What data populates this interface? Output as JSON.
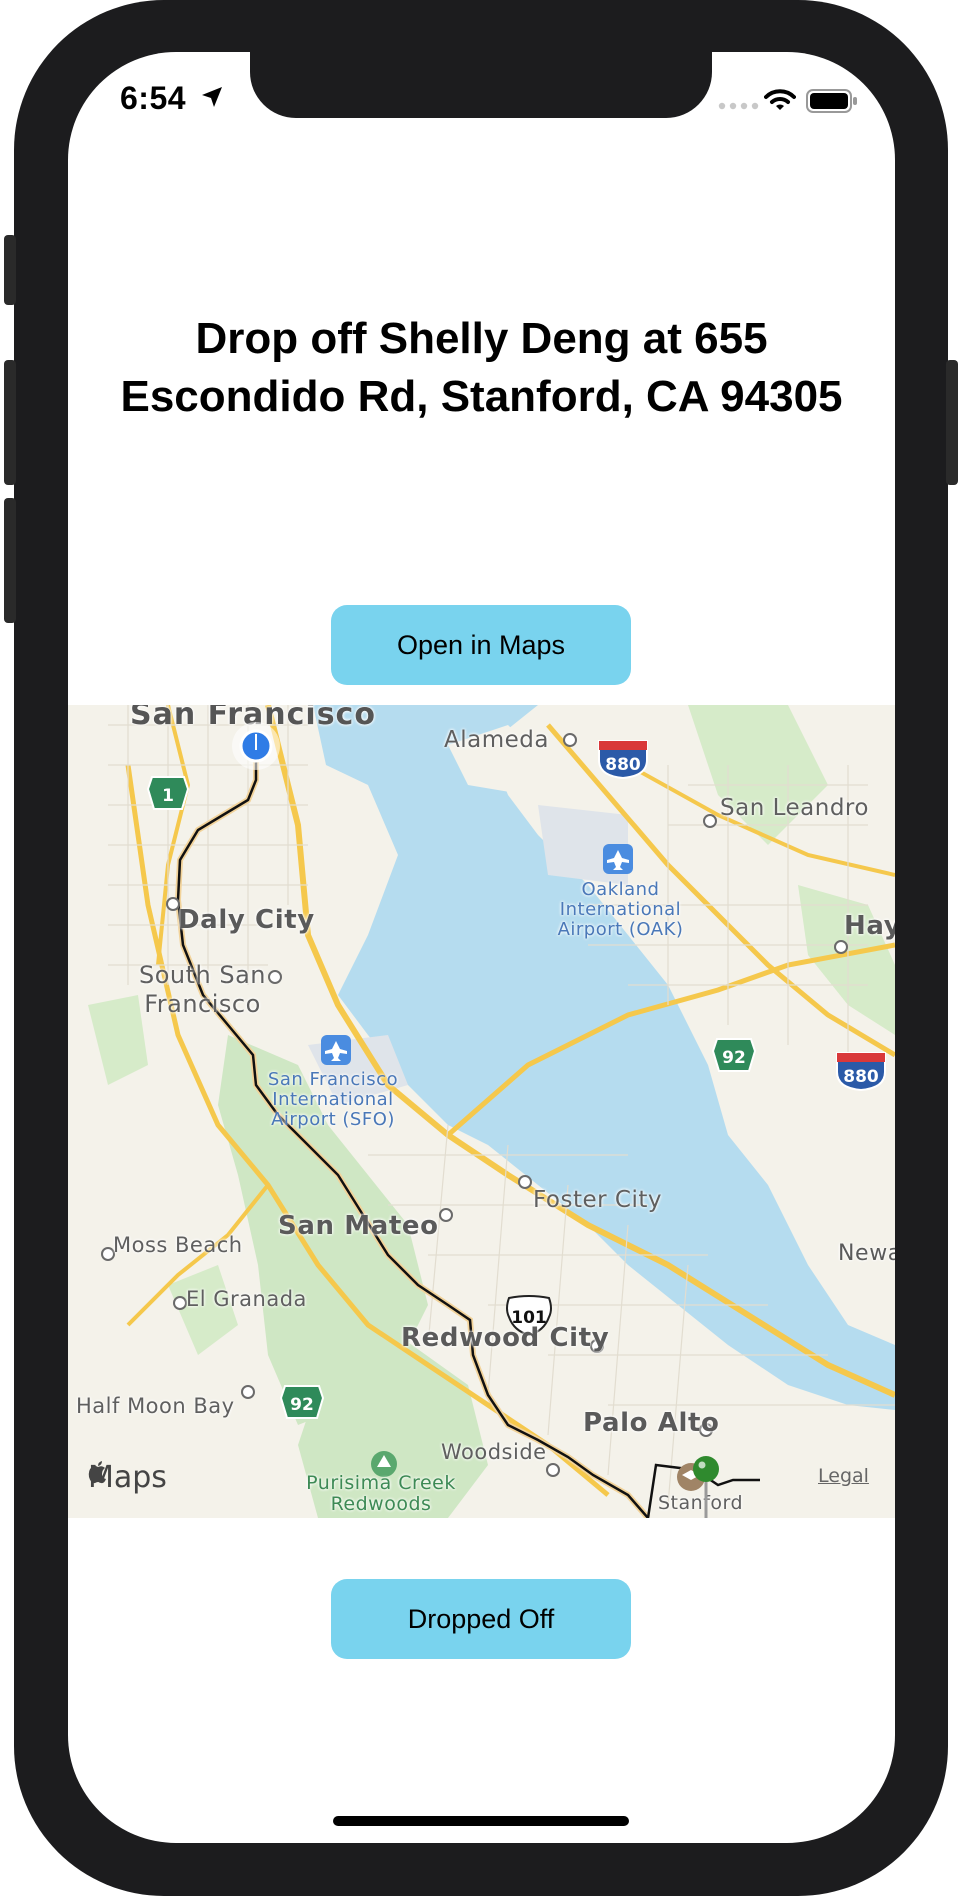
{
  "status_bar": {
    "time": "6:54"
  },
  "header": {
    "title": "Drop off Shelly Deng at 655 Escondido Rd, Stanford, CA 94305"
  },
  "buttons": {
    "open_in_maps": "Open in Maps",
    "dropped_off": "Dropped Off"
  },
  "map": {
    "labels": {
      "san_francisco": "San Francisco",
      "alameda": "Alameda",
      "san_leandro": "San Leandro",
      "daly_city": "Daly City",
      "south_sf": "South San Francisco",
      "hay": "Hay",
      "oakland_airport": "Oakland International Airport (OAK)",
      "sfo": "San Francisco International Airport (SFO)",
      "foster_city": "Foster City",
      "san_mateo": "San Mateo",
      "moss_beach": "Moss Beach",
      "newa": "Newa",
      "el_granada": "El Granada",
      "redwood_city": "Redwood City",
      "half_moon_bay": "Half Moon Bay",
      "palo_alto": "Palo Alto",
      "woodside": "Woodside",
      "purisima": "Purisima Creek Redwoods",
      "stanford": "Stanford"
    },
    "shields": {
      "i880_top": "880",
      "i880_right": "880",
      "ca1": "1",
      "ca92_right": "92",
      "ca92_left": "92",
      "us101": "101"
    },
    "logo": "Maps",
    "legal": "Legal"
  },
  "colors": {
    "button": "#79d3ee",
    "water": "#b5dcef",
    "land": "#f4f2ea",
    "park": "#cfe7c4",
    "route": "#111111",
    "pin_green": "#2f8a2e",
    "user_dot": "#2f7ce6"
  }
}
